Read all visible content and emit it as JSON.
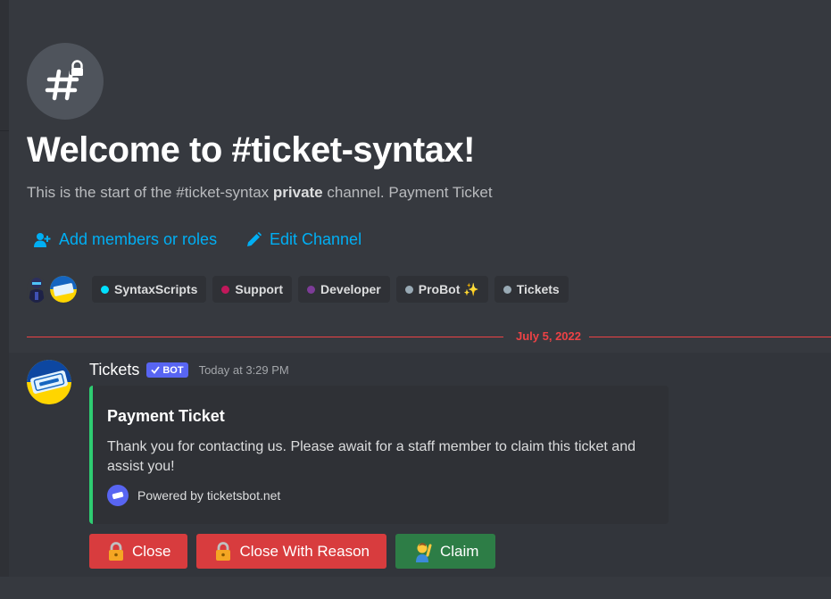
{
  "channel_header": {
    "icon": "hashtag-lock-icon",
    "title": "Welcome to #ticket-syntax!",
    "description_prefix": "This is the start of the #ticket-syntax ",
    "description_bold": "private",
    "description_suffix": " channel. Payment Ticket"
  },
  "actions": {
    "add_members_label": "Add members or roles",
    "edit_channel_label": "Edit Channel"
  },
  "member_avatars": [
    "user-avatar",
    "tickets-bot-avatar"
  ],
  "roles": [
    {
      "name": "SyntaxScripts",
      "color": "#1abc9c"
    },
    {
      "name": "Support",
      "color": "#c2185b"
    },
    {
      "name": "Developer",
      "color": "#7d3c98"
    },
    {
      "name": "ProBot ✨",
      "color": "#99aab5"
    },
    {
      "name": "Tickets",
      "color": "#99aab5"
    }
  ],
  "divider": {
    "date": "July 5, 2022"
  },
  "message": {
    "author": "Tickets",
    "bot_tag": "BOT",
    "timestamp": "Today at 3:29 PM",
    "embed": {
      "accent_color": "#2ecc71",
      "title": "Payment Ticket",
      "description": "Thank you for contacting us. Please await for a staff member to claim this ticket and assist you!",
      "footer": "Powered by ticketsbot.net"
    },
    "buttons": [
      {
        "label": "Close",
        "emoji": "lock-icon",
        "color": "#d83c3e"
      },
      {
        "label": "Close With Reason",
        "emoji": "lock-icon",
        "color": "#d83c3e"
      },
      {
        "label": "Claim",
        "emoji": "person-raising-hand-icon",
        "color": "#2d7d46"
      }
    ]
  },
  "colors": {
    "background": "#36393f",
    "link": "#00aff4",
    "divider": "#ed4245",
    "bot_tag": "#5865f2"
  }
}
